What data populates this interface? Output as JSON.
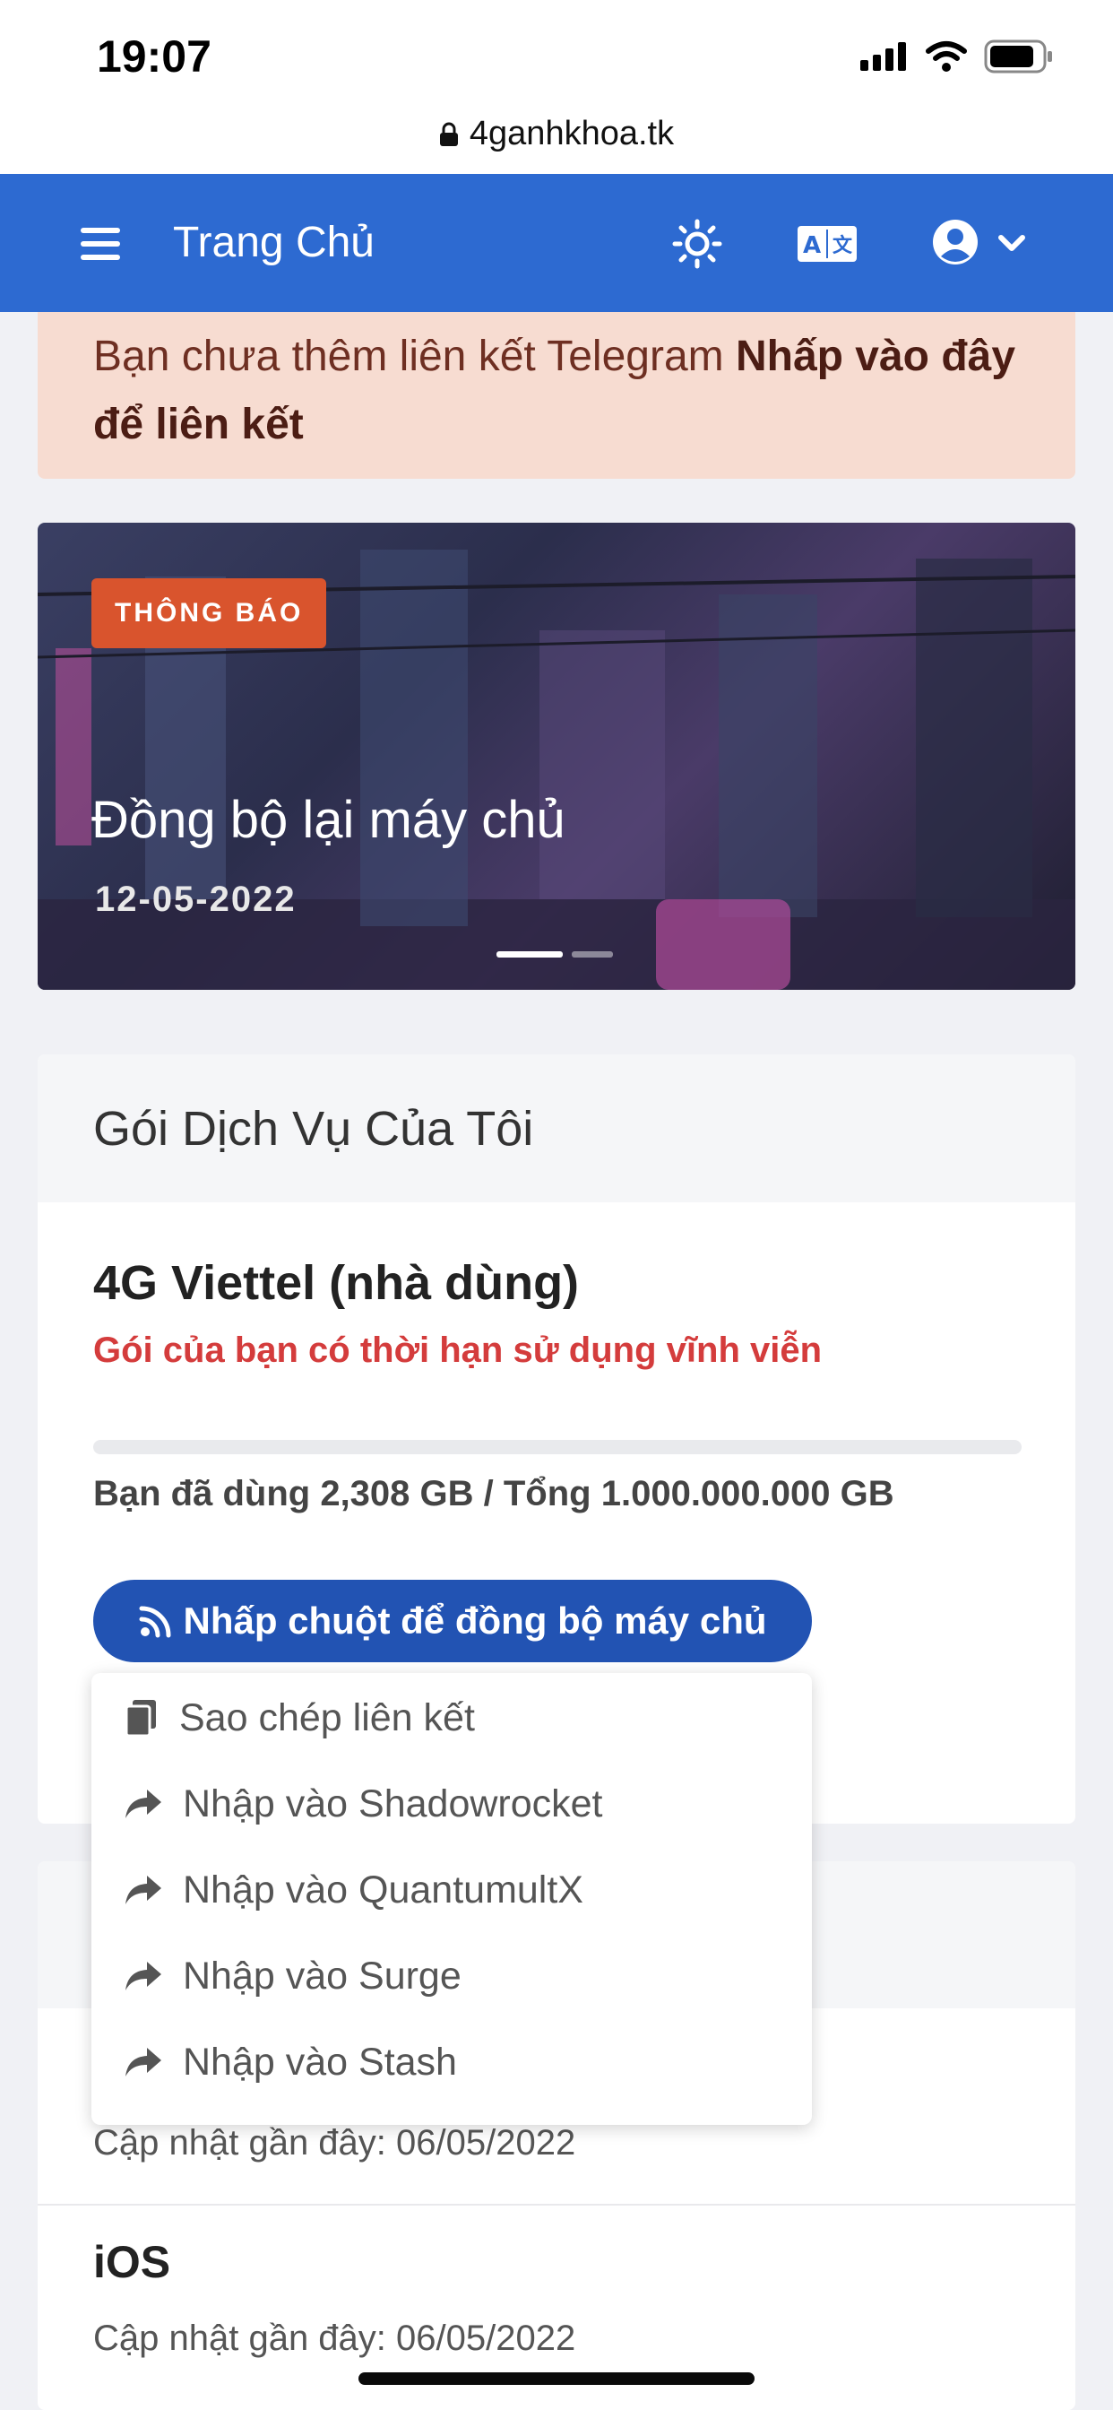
{
  "status_bar": {
    "time": "19:07"
  },
  "browser": {
    "url": "4ganhkhoa.tk"
  },
  "header": {
    "title": "Trang Chủ"
  },
  "alert": {
    "text": "Bạn chưa thêm liên kết Telegram ",
    "link": "Nhấp vào đây để liên kết"
  },
  "banner": {
    "badge": "THÔNG BÁO",
    "title": "Đồng bộ lại máy chủ",
    "date": "12-05-2022"
  },
  "subscription": {
    "card_title": "Gói Dịch Vụ Của Tôi",
    "plan_name": "4G Viettel (nhà dùng)",
    "expiry": "Gói của bạn có thời hạn sử dụng vĩnh viễn",
    "usage_fraction": 0.0,
    "usage_text": "Bạn đã dùng 2,308 GB / Tổng 1.000.000.000 GB",
    "sync_button": "Nhấp chuột để đồng bộ máy chủ"
  },
  "dropdown": {
    "items": [
      {
        "label": "Sao chép liên kết",
        "icon": "copy-icon"
      },
      {
        "label": "Nhập vào Shadowrocket",
        "icon": "share-arrow-icon"
      },
      {
        "label": "Nhập vào QuantumultX",
        "icon": "share-arrow-icon"
      },
      {
        "label": "Nhập vào Surge",
        "icon": "share-arrow-icon"
      },
      {
        "label": "Nhập vào Stash",
        "icon": "share-arrow-icon"
      }
    ]
  },
  "apps": {
    "items": [
      {
        "name": "",
        "updated": "Cập nhật gần đây: 06/05/2022"
      },
      {
        "name": "iOS",
        "updated": "Cập nhật gần đây: 06/05/2022"
      }
    ]
  },
  "colors": {
    "primary": "#2d6ad1",
    "button": "#2253b3",
    "alert_bg": "#f7dcd1",
    "badge": "#d9542d",
    "danger": "#d43c3c"
  }
}
